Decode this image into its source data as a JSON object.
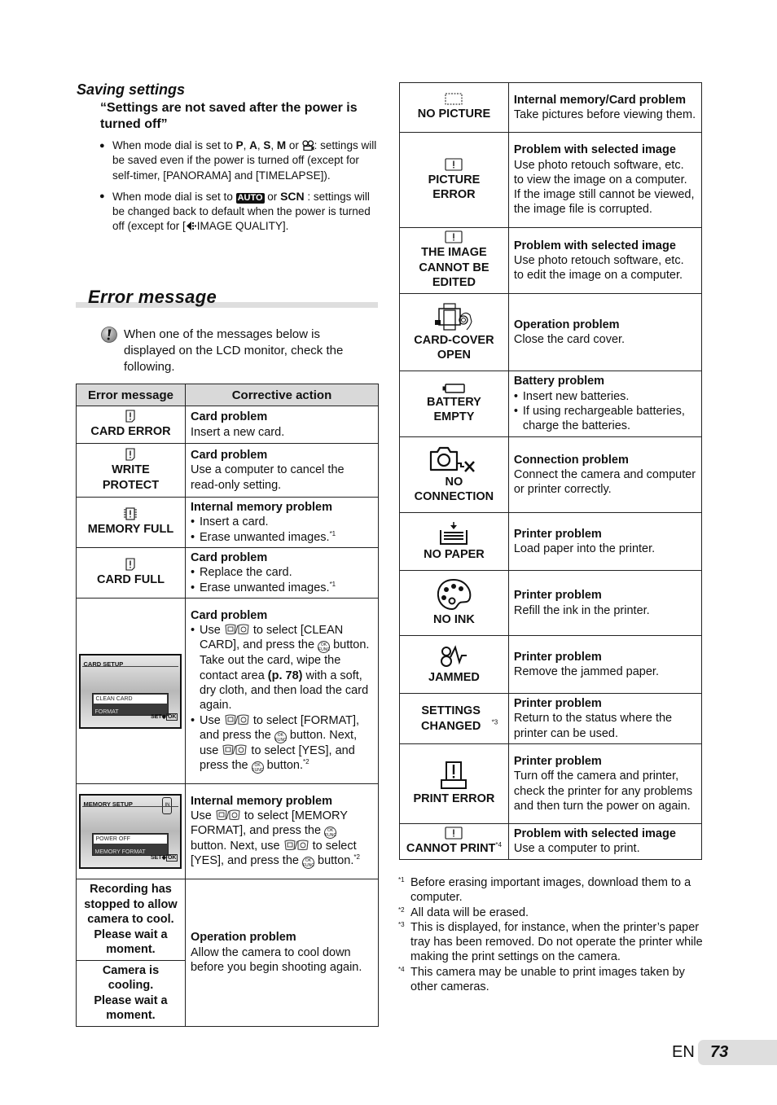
{
  "saving": {
    "heading": "Saving settings",
    "quote": "“Settings are not saved after the power is turned off”",
    "bullet1": {
      "pre": "When mode dial is set to ",
      "modes": [
        "P",
        "A",
        "S",
        "M"
      ],
      "sep": ", ",
      "or": " or ",
      "mode_icon": "movie-icon",
      "post": ": settings will be saved even if the power is turned off (except for self-timer, [PANORAMA] and [TIMELAPSE])."
    },
    "bullet2": {
      "pre": "When mode dial is set to ",
      "auto": "AUTO",
      "or": " or ",
      "scn": "SCN",
      "post": " : settings will be changed back to default when the power is turned off (except for [",
      "quality_icon": "image-quality-icon",
      "post2": "IMAGE QUALITY]."
    }
  },
  "section": {
    "title": "Error message",
    "caution": "When one of the messages below is displayed on the LCD monitor, check the following."
  },
  "table_left": {
    "headers": [
      "Error message",
      "Corrective action"
    ],
    "rows": [
      {
        "icon": "card-error-icon",
        "msg": "CARD ERROR",
        "title": "Card problem",
        "text": "Insert a new card."
      },
      {
        "icon": "card-error-icon",
        "msg": "WRITE PROTECT",
        "title": "Card problem",
        "text": "Use a computer to cancel the read-only setting."
      },
      {
        "icon": "memory-error-icon",
        "msg": "MEMORY FULL",
        "title": "Internal memory problem",
        "items": [
          "Insert a card.",
          "Erase unwanted images."
        ],
        "item2_note": "*1"
      },
      {
        "icon": "card-error-icon",
        "msg": "CARD FULL",
        "title": "Card problem",
        "items": [
          "Replace the card.",
          "Erase unwanted images."
        ],
        "item2_note": "*1"
      },
      {
        "screen": {
          "title": "CARD SETUP",
          "item1": "CLEAN CARD",
          "item2": "FORMAT",
          "set": "SET",
          "ok": "OK"
        },
        "title": "Card problem",
        "b1a": " Use ",
        "b1b": " to select [CLEAN CARD], and press the ",
        "b1c": " button. Take out the card, wipe the contact area ",
        "b1ref": "(p. 78)",
        "b1d": " with a soft, dry cloth, and then load the card again.",
        "b2a": " Use ",
        "b2b": " to select [FORMAT], and press the ",
        "b2c": " button. Next, use ",
        "b2d": " to select [YES], and press the ",
        "b2e": " button.",
        "note": "*2"
      },
      {
        "screen": {
          "title": "MEMORY SETUP",
          "badge": "IN",
          "item1": "POWER OFF",
          "item2": "MEMORY FORMAT",
          "set": "SET",
          "ok": "OK"
        },
        "title": "Internal memory problem",
        "t1": "Use ",
        "t2": " to select [MEMORY FORMAT], and press the ",
        "t3": " button. Next, use ",
        "t4": " to select [YES], and press the ",
        "t5": " button.",
        "note": "*2"
      },
      {
        "msg": "Recording has stopped to allow camera to cool. Please wait a moment.",
        "msg2": "Camera is cooling. Please wait a moment.",
        "title": "Operation problem",
        "text": "Allow the camera to cool down before you begin shooting again."
      }
    ],
    "ok_label_top": "OK",
    "ok_label_bottom": "FUNC"
  },
  "table_right": {
    "rows": [
      {
        "icon": "no-picture-icon",
        "msg": "NO PICTURE",
        "title": "Internal memory/Card problem",
        "text": "Take pictures before viewing them."
      },
      {
        "icon": "picture-error-icon",
        "msg": "PICTURE ERROR",
        "title": "Problem with selected image",
        "text": "Use photo retouch software, etc. to view the image on a computer. If the image still cannot be viewed, the image file is corrupted."
      },
      {
        "icon": "picture-error-icon",
        "msg": "THE IMAGE CANNOT BE EDITED",
        "title": "Problem with selected image",
        "text": "Use photo retouch software, etc. to edit the image on a computer."
      },
      {
        "icon": "card-cover-open-icon",
        "msg": "CARD-COVER OPEN",
        "title": "Operation problem",
        "text": "Close the card cover."
      },
      {
        "icon": "battery-empty-icon",
        "msg": "BATTERY EMPTY",
        "title": "Battery problem",
        "items": [
          "Insert new batteries.",
          "If using rechargeable batteries, charge the batteries."
        ]
      },
      {
        "icon": "no-connection-icon",
        "msg": "NO CONNECTION",
        "title": "Connection problem",
        "text": "Connect the camera and computer or printer correctly."
      },
      {
        "icon": "no-paper-icon",
        "msg": "NO PAPER",
        "title": "Printer problem",
        "text": "Load paper into the printer."
      },
      {
        "icon": "no-ink-icon",
        "msg": "NO INK",
        "title": "Printer problem",
        "text": "Refill the ink in the printer."
      },
      {
        "icon": "jammed-icon",
        "msg": "JAMMED",
        "title": "Printer problem",
        "text": "Remove the jammed paper."
      },
      {
        "msg": "SETTINGS CHANGED",
        "note": "*3",
        "title": "Printer problem",
        "text": "Return to the status where the printer can be used."
      },
      {
        "icon": "print-error-icon",
        "msg": "PRINT ERROR",
        "title": "Printer problem",
        "text": "Turn off the camera and printer, check the printer for any problems and then turn the power on again."
      },
      {
        "icon": "picture-error-icon",
        "msg": "CANNOT PRINT",
        "note": "*4",
        "title": "Problem with selected image",
        "text": "Use a computer to print."
      }
    ]
  },
  "footnotes": [
    {
      "mark": "*1",
      "text": "Before erasing important images, download them to a computer."
    },
    {
      "mark": "*2",
      "text": "All data will be erased."
    },
    {
      "mark": "*3",
      "text": "This is displayed, for instance, when the printer’s paper tray has been removed. Do not operate the printer while making the print settings on the camera."
    },
    {
      "mark": "*4",
      "text": "This camera may be unable to print images taken by other cameras."
    }
  ],
  "page": {
    "lang": "EN",
    "number": "73"
  }
}
